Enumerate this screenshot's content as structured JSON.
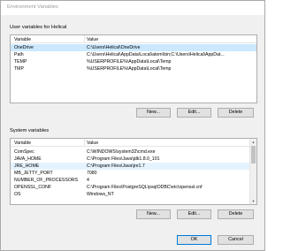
{
  "window": {
    "title": "Environment Variables"
  },
  "user_vars": {
    "label": "User variables for Helical",
    "headers": {
      "variable": "Variable",
      "value": "Value"
    },
    "rows": [
      {
        "variable": "OneDrive",
        "value": "C:\\Users\\Helical\\OneDrive",
        "selected": true
      },
      {
        "variable": "Path",
        "value": "C:\\Users\\Helical\\AppData\\Local\\atom\\bin;C:\\Users\\Helical\\AppDat...",
        "selected": false
      },
      {
        "variable": "TEMP",
        "value": "%USERPROFILE%\\AppData\\Local\\Temp",
        "selected": false
      },
      {
        "variable": "TMP",
        "value": "%USERPROFILE%\\AppData\\Local\\Temp",
        "selected": false
      }
    ],
    "buttons": {
      "new": "New...",
      "edit": "Edit...",
      "delete": "Delete"
    }
  },
  "system_vars": {
    "label": "System variables",
    "headers": {
      "variable": "Variable",
      "value": "Value"
    },
    "rows": [
      {
        "variable": "ComSpec",
        "value": "C:\\WINDOWS\\system32\\cmd.exe",
        "selected": false
      },
      {
        "variable": "JAVA_HOME",
        "value": "C:\\Program Files\\Java\\jdk1.8.0_101",
        "selected": false
      },
      {
        "variable": "JRE_HOME",
        "value": "C:\\Program Files\\Java\\jre1.7",
        "selected": true
      },
      {
        "variable": "MB_JETTY_PORT",
        "value": "7080",
        "selected": false
      },
      {
        "variable": "NUMBER_OF_PROCESSORS",
        "value": "4",
        "selected": false
      },
      {
        "variable": "OPENSSL_CONF",
        "value": "C:\\Program Files\\PostgreSQL\\psqlODBC\\etc\\openssl.cnf",
        "selected": false
      },
      {
        "variable": "OS",
        "value": "Windows_NT",
        "selected": false
      }
    ],
    "buttons": {
      "new": "New...",
      "edit": "Edit...",
      "delete": "Delete"
    }
  },
  "dialog_buttons": {
    "ok": "OK",
    "cancel": "Cancel"
  },
  "colors": {
    "selection": "#cce8ff",
    "accent": "#0078d7"
  }
}
